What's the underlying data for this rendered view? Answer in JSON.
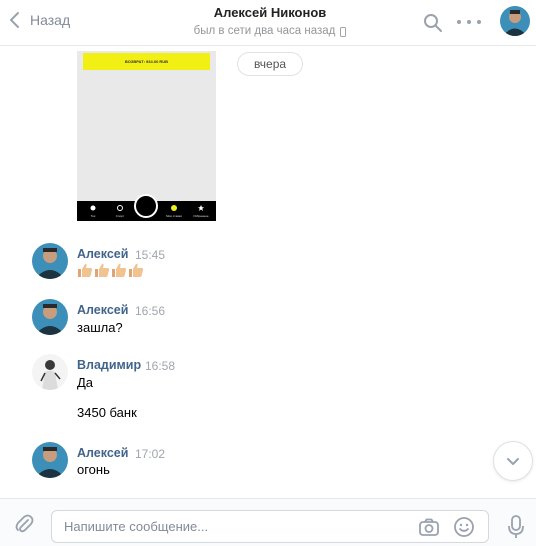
{
  "header": {
    "back_label": "Назад",
    "contact_name": "Алексей Никонов",
    "status": "был в сети два часа назад"
  },
  "screenshot": {
    "banner_text": "ВОЗВРАТ: 934.00 RUB",
    "nav_labels": [
      "Ток",
      "Спорт",
      "",
      "Мои ставки",
      "Избранное"
    ]
  },
  "date_separator": "вчера",
  "messages": [
    {
      "author": "Алексей",
      "time": "15:45",
      "lines": []
    },
    {
      "author": "Алексей",
      "time": "16:56",
      "lines": [
        "зашла?"
      ]
    },
    {
      "author": "Владимир",
      "time": "16:58",
      "lines": [
        "Да",
        "3450 банк"
      ]
    },
    {
      "author": "Алексей",
      "time": "17:02",
      "lines": [
        "огонь"
      ]
    }
  ],
  "composer": {
    "placeholder": "Напишите сообщение..."
  },
  "colors": {
    "link": "#42648b",
    "muted": "#828a99",
    "banner": "#f2ef15"
  },
  "icons": [
    "back-chevron-icon",
    "search-icon",
    "more-icon",
    "attach-icon",
    "camera-icon",
    "smile-icon",
    "mic-icon",
    "chevron-down-icon",
    "thumbs-up-icon",
    "phone-icon"
  ]
}
